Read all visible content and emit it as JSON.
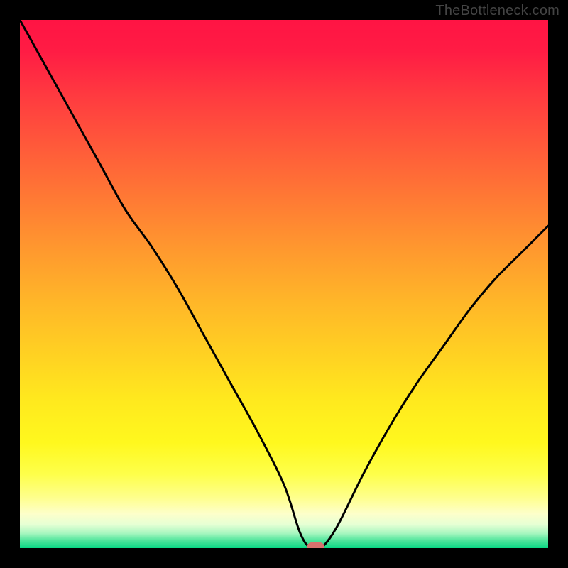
{
  "watermark": "TheBottleneck.com",
  "chart_data": {
    "type": "line",
    "title": "",
    "xlabel": "",
    "ylabel": "",
    "xlim": [
      0,
      100
    ],
    "ylim": [
      0,
      100
    ],
    "x": [
      0,
      5,
      10,
      15,
      20,
      25,
      30,
      35,
      40,
      45,
      50,
      53,
      55,
      57,
      60,
      65,
      70,
      75,
      80,
      85,
      90,
      95,
      100
    ],
    "values": [
      100,
      91,
      82,
      73,
      64,
      57,
      49,
      40,
      31,
      22,
      12,
      3,
      0,
      0,
      4,
      14,
      23,
      31,
      38,
      45,
      51,
      56,
      61
    ],
    "annotations": [
      {
        "shape": "pill",
        "x": 56,
        "y": 0,
        "color": "#d9716e"
      }
    ],
    "background_gradient": {
      "stops": [
        {
          "offset": 0.0,
          "color": "#ff1444"
        },
        {
          "offset": 0.06,
          "color": "#ff1c44"
        },
        {
          "offset": 0.14,
          "color": "#ff3940"
        },
        {
          "offset": 0.24,
          "color": "#ff5a3a"
        },
        {
          "offset": 0.34,
          "color": "#ff7a34"
        },
        {
          "offset": 0.44,
          "color": "#ff9a2e"
        },
        {
          "offset": 0.54,
          "color": "#ffb828"
        },
        {
          "offset": 0.64,
          "color": "#ffd322"
        },
        {
          "offset": 0.72,
          "color": "#ffe91e"
        },
        {
          "offset": 0.8,
          "color": "#fff81e"
        },
        {
          "offset": 0.86,
          "color": "#feff4a"
        },
        {
          "offset": 0.905,
          "color": "#feff8e"
        },
        {
          "offset": 0.935,
          "color": "#fdffca"
        },
        {
          "offset": 0.955,
          "color": "#e6ffd4"
        },
        {
          "offset": 0.972,
          "color": "#a8f7c0"
        },
        {
          "offset": 0.986,
          "color": "#4de49b"
        },
        {
          "offset": 1.0,
          "color": "#09d884"
        }
      ]
    }
  }
}
